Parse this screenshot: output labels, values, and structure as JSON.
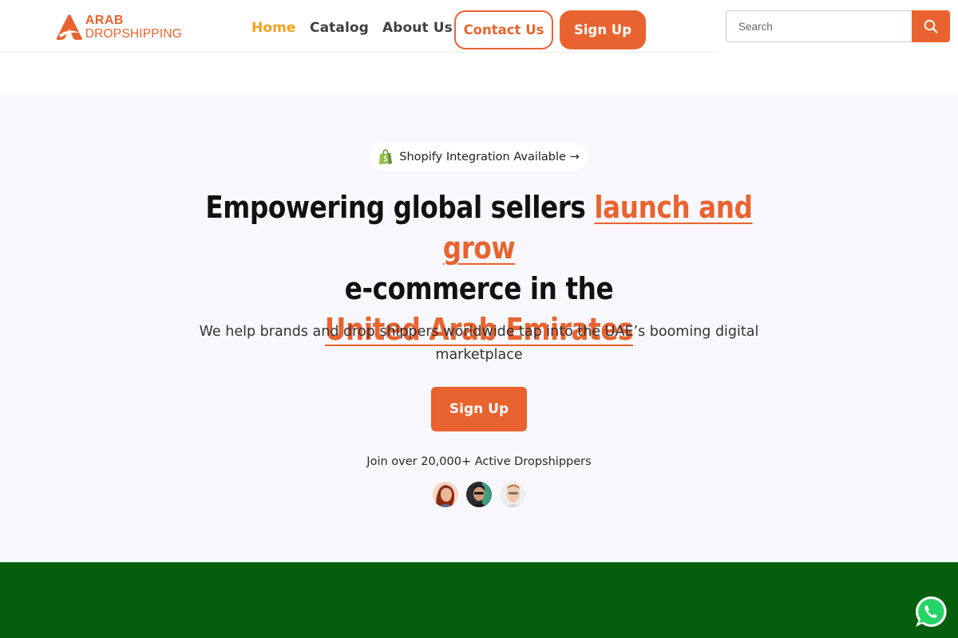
{
  "brand": {
    "logo_line1": "ARAB",
    "logo_line2": "DROPSHIPPING",
    "accent_color": "#e8632f",
    "active_nav_color": "#f4a01c",
    "footer_band_color": "#065e0c"
  },
  "nav": {
    "home": "Home",
    "catalog": "Catalog",
    "about": "About Us",
    "contact": "Contact Us",
    "signup": "Sign Up"
  },
  "search": {
    "placeholder": "Search",
    "icon": "search-icon"
  },
  "hero": {
    "pill_text": "Shopify Integration Available →",
    "pill_icon": "shopify-bag-icon",
    "headline_part1": "Empowering global sellers ",
    "headline_accent1": "launch and grow",
    "headline_part2": "e-commerce in the",
    "headline_accent2": "United Arab Emirates",
    "subtitle": "We help brands and drop shippers worldwide tap into the UAE’s booming digital marketplace",
    "cta": "Sign Up",
    "social_proof": "Join over 20,000+ Active Dropshippers",
    "avatars": [
      "avatar-1",
      "avatar-2",
      "avatar-3"
    ]
  },
  "floating": {
    "whatsapp_icon": "whatsapp-icon"
  }
}
